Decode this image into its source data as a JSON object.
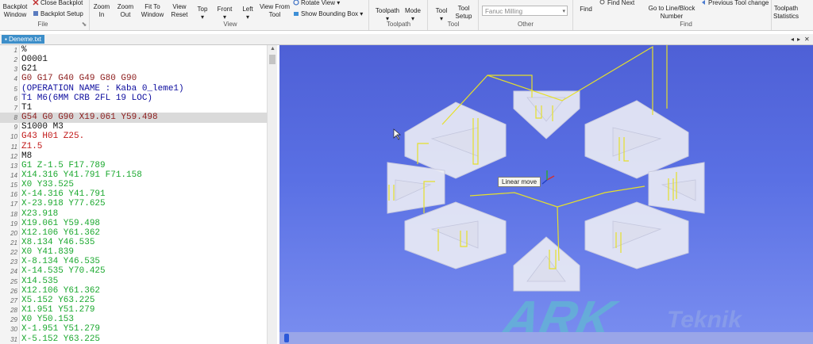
{
  "ribbon": {
    "buttons": {
      "backplot_window": "Backplot\nWindow",
      "close_backplot": "Close Backplot",
      "backplot_setup": "Backplot Setup",
      "zoom_in": "Zoom\nIn",
      "zoom_out": "Zoom\nOut",
      "fit_to_window": "Fit To\nWindow",
      "view_reset": "View\nReset",
      "top": "Top",
      "front": "Front",
      "left": "Left",
      "view_from_tool": "View From\nTool",
      "rotate_view": "Rotate View",
      "show_bounding_box": "Show Bounding Box",
      "toolpath": "Toolpath",
      "mode": "Mode",
      "tool": "Tool",
      "tool_setup": "Tool\nSetup",
      "find": "Find",
      "find_next": "Find Next",
      "go_to_line": "Go to Line/Block\nNumber",
      "previous_tool_change": "Previous Tool change",
      "toolpath_statistics": "Toolpath\nStatistics"
    },
    "machine_select": "Fanuc Milling",
    "groups": {
      "file": "File",
      "view": "View",
      "toolpath": "Toolpath",
      "tool": "Tool",
      "other": "Other",
      "find": "Find"
    }
  },
  "document": {
    "tab": "Deneme.txt"
  },
  "editor": {
    "highlighted_line": 8,
    "colors": {
      "blue": "#0d0d9e",
      "maroon": "#8b1a1a",
      "black": "#111111",
      "green": "#1aa82e",
      "red": "#c01515"
    },
    "lines": [
      {
        "n": "1",
        "text": "%",
        "color": "black"
      },
      {
        "n": "2",
        "text": "O0001",
        "color": "black"
      },
      {
        "n": "3",
        "text": "G21",
        "color": "black"
      },
      {
        "n": "4",
        "text": "G0 G17 G40 G49 G80 G90",
        "color": "maroon"
      },
      {
        "n": "5",
        "text": "(OPERATION NAME : Kaba 0_leme1)",
        "color": "blue"
      },
      {
        "n": "6",
        "text": "T1 M6(6MM CRB 2FL 19 LOC)",
        "color": "blue"
      },
      {
        "n": "7",
        "text": "T1",
        "color": "black"
      },
      {
        "n": "8",
        "text": "G54 G0 G90 X19.061 Y59.498",
        "color": "maroon"
      },
      {
        "n": "9",
        "text": "S1000 M3",
        "color": "black"
      },
      {
        "n": "10",
        "text": "G43 H01 Z25.",
        "color": "red"
      },
      {
        "n": "11",
        "text": "Z1.5",
        "color": "red"
      },
      {
        "n": "12",
        "text": "M8",
        "color": "black"
      },
      {
        "n": "13",
        "text": "G1 Z-1.5 F17.789",
        "color": "green"
      },
      {
        "n": "14",
        "text": "X14.316 Y41.791 F71.158",
        "color": "green"
      },
      {
        "n": "15",
        "text": "X0 Y33.525",
        "color": "green"
      },
      {
        "n": "16",
        "text": "X-14.316 Y41.791",
        "color": "green"
      },
      {
        "n": "17",
        "text": "X-23.918 Y77.625",
        "color": "green"
      },
      {
        "n": "18",
        "text": "X23.918",
        "color": "green"
      },
      {
        "n": "19",
        "text": "X19.061 Y59.498",
        "color": "green"
      },
      {
        "n": "20",
        "text": "X12.106 Y61.362",
        "color": "green"
      },
      {
        "n": "21",
        "text": "X8.134 Y46.535",
        "color": "green"
      },
      {
        "n": "22",
        "text": "X0 Y41.839",
        "color": "green"
      },
      {
        "n": "23",
        "text": "X-8.134 Y46.535",
        "color": "green"
      },
      {
        "n": "24",
        "text": "X-14.535 Y70.425",
        "color": "green"
      },
      {
        "n": "25",
        "text": "X14.535",
        "color": "green"
      },
      {
        "n": "26",
        "text": "X12.106 Y61.362",
        "color": "green"
      },
      {
        "n": "27",
        "text": "X5.152 Y63.225",
        "color": "green"
      },
      {
        "n": "28",
        "text": "X1.951 Y51.279",
        "color": "green"
      },
      {
        "n": "29",
        "text": "X0 Y50.153",
        "color": "green"
      },
      {
        "n": "30",
        "text": "X-1.951 Y51.279",
        "color": "green"
      },
      {
        "n": "31",
        "text": "X-5.152 Y63.225",
        "color": "green"
      }
    ]
  },
  "viewport": {
    "tooltip": "Linear move",
    "watermark_1": "ARK",
    "watermark_2": "Teknik"
  },
  "colors": {
    "viewport_top": "#4e60d6",
    "viewport_bottom": "#7a8ef0",
    "part_fill": "#ecedf5",
    "toolpath": "#e6e02a",
    "accent": "#3c8ec9"
  }
}
